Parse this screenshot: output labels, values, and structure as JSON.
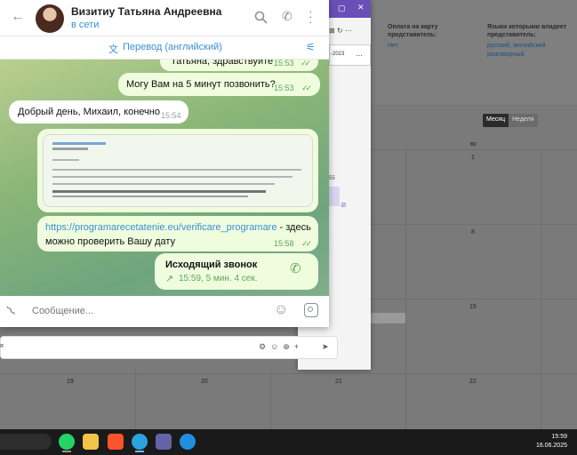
{
  "background_app": {
    "col1_header": "Оплата на карту представитель:",
    "col1_value": "Нет",
    "col2_header": "Языки которыми владеет представитель:",
    "col2_value": "русский, английский разговорный.",
    "toggle_month": "Месяц",
    "toggle_week": "Неделя",
    "weekday_label": "вс",
    "day_numbers": [
      "1",
      "8",
      "15",
      "19",
      "20",
      "21",
      "22"
    ],
    "partial_date": "-2023",
    "partial_text_a": "55",
    "partial_text_b": "я"
  },
  "chat": {
    "contact_name": "Визитиу Татьяна Андреевна",
    "status": "в сети",
    "translate_label": "Перевод (английский)",
    "input_placeholder": "Сообщение...",
    "messages": [
      {
        "text": "Татьяна, здравствуйте",
        "time": "15:53"
      },
      {
        "text": "Могу Вам на 5 минут позвонить?",
        "time": "15:53"
      },
      {
        "text": "Добрый день, Михаил, конечно",
        "time": "15:54"
      },
      {
        "link": "https://programarecetatenie.eu/verificare_programare",
        "text": " - здесь можно проверить Вашу дату",
        "time": "15:58"
      }
    ],
    "call": {
      "title": "Исходящий звонок",
      "detail": "15:59, 5 мин. 4 сек."
    }
  },
  "taskbar": {
    "time": "15:59",
    "date": "16.06.2025"
  },
  "colors": {
    "accent": "#3a8fd6",
    "out_bubble": "#effdde",
    "check": "#5fa55a"
  }
}
